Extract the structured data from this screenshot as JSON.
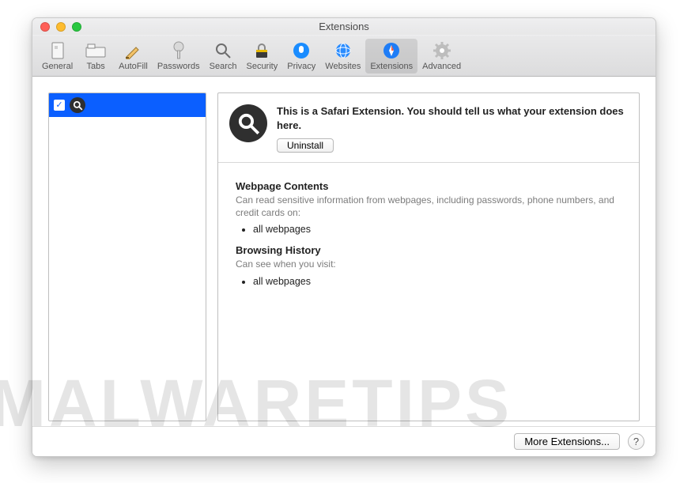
{
  "window": {
    "title": "Extensions"
  },
  "toolbar": {
    "items": [
      {
        "label": "General"
      },
      {
        "label": "Tabs"
      },
      {
        "label": "AutoFill"
      },
      {
        "label": "Passwords"
      },
      {
        "label": "Search"
      },
      {
        "label": "Security"
      },
      {
        "label": "Privacy"
      },
      {
        "label": "Websites"
      },
      {
        "label": "Extensions"
      },
      {
        "label": "Advanced"
      }
    ]
  },
  "sidebar": {
    "selected": {
      "enabled": true,
      "icon": "search-icon"
    }
  },
  "detail": {
    "description": "This is a Safari Extension. You should tell us what your extension does here.",
    "uninstall_label": "Uninstall",
    "sections": [
      {
        "title": "Webpage Contents",
        "subtitle": "Can read sensitive information from webpages, including passwords, phone numbers, and credit cards on:",
        "items": [
          "all webpages"
        ]
      },
      {
        "title": "Browsing History",
        "subtitle": "Can see when you visit:",
        "items": [
          "all webpages"
        ]
      }
    ]
  },
  "footer": {
    "more_label": "More Extensions...",
    "help_label": "?"
  },
  "watermark": "MALWARETIPS"
}
